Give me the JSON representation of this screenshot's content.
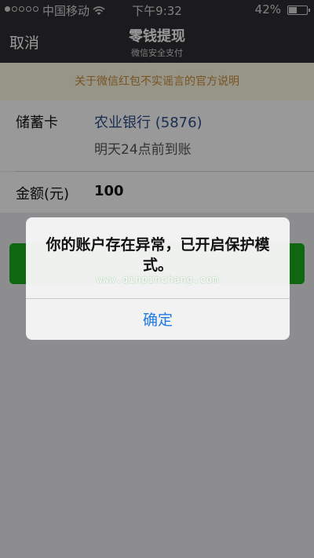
{
  "status_bar": {
    "carrier": "中国移动",
    "time": "下午9:32",
    "battery": "42%",
    "battery_level": 0.42,
    "signal_bars": 1,
    "signal_total": 5
  },
  "nav": {
    "cancel_label": "取消",
    "title": "零钱提现",
    "subtitle": "微信安全支付"
  },
  "notice": {
    "text": "关于微信红包不实谣言的官方说明"
  },
  "form": {
    "card_label": "储蓄卡",
    "bank": "农业银行 (5876)",
    "arrival": "明天24点前到账",
    "amount_label": "金额(元)",
    "amount": "100"
  },
  "alert": {
    "message": "你的账户存在异常，已开启保护模式。",
    "watermark": "www.qinpinchang.com",
    "confirm_label": "确定"
  },
  "colors": {
    "accent_green": "#1aad19",
    "link_blue": "#1f7ae0",
    "notice_text": "#c88c3a",
    "nav_background": "#2d2e32"
  }
}
